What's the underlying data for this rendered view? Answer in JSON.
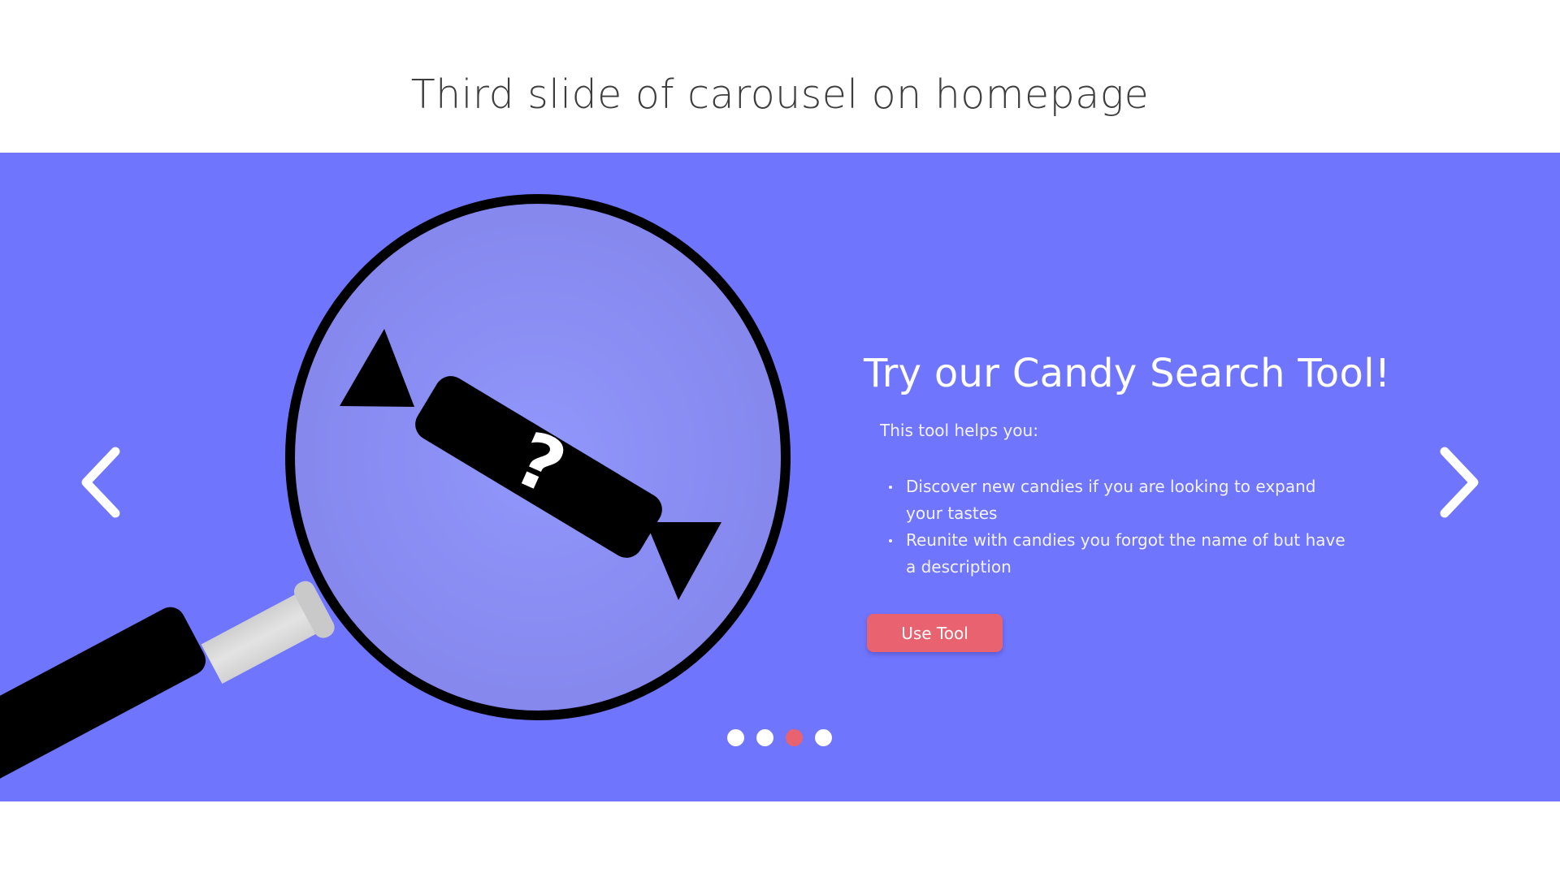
{
  "page": {
    "heading": "Third slide of carousel on homepage"
  },
  "carousel": {
    "background_color": "#7075fe",
    "slide_title": "Try our Candy Search Tool!",
    "intro": "This tool helps you:",
    "benefits": [
      "Discover new candies if you are looking to expand your tastes",
      "Reunite with candies you forgot the name of but have a description"
    ],
    "cta_label": "Use Tool",
    "cta_color": "#e8626f",
    "prev_icon": "chevron-left-icon",
    "next_icon": "chevron-right-icon",
    "illustration": {
      "icon": "magnifying-glass-icon",
      "subject": "candy-icon",
      "symbol": "?"
    },
    "slide_count": 4,
    "active_slide": 3
  }
}
